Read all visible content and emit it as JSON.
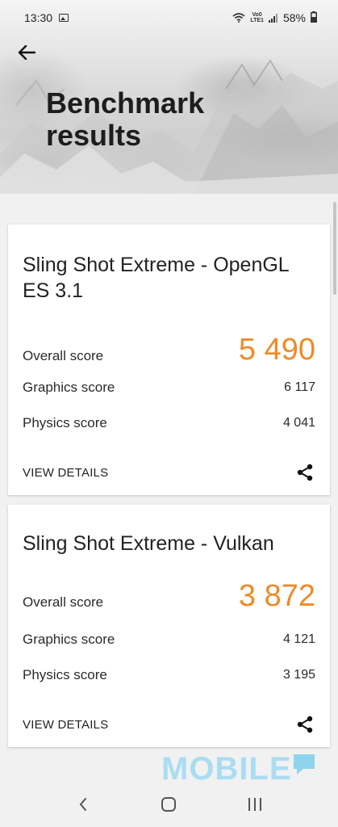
{
  "status_bar": {
    "time": "13:30",
    "volte_line1": "Vo0",
    "volte_line2": "LTE1",
    "battery": "58%"
  },
  "header": {
    "title": "Benchmark results"
  },
  "cards": [
    {
      "title": "Sling Shot Extreme - OpenGL ES 3.1",
      "overall_label": "Overall score",
      "overall_value": "5 490",
      "graphics_label": "Graphics score",
      "graphics_value": "6 117",
      "physics_label": "Physics score",
      "physics_value": "4 041",
      "details_label": "VIEW DETAILS"
    },
    {
      "title": "Sling Shot Extreme - Vulkan",
      "overall_label": "Overall score",
      "overall_value": "3 872",
      "graphics_label": "Graphics score",
      "graphics_value": "4 121",
      "physics_label": "Physics score",
      "physics_value": "3 195",
      "details_label": "VIEW DETAILS"
    }
  ],
  "watermark": "MOBILE",
  "colors": {
    "accent": "#ee8a28",
    "watermark": "#a9ddf2"
  },
  "icons": {
    "back": "arrow-left-icon",
    "share": "share-icon",
    "nav_back": "chevron-left-icon",
    "nav_home": "home-icon",
    "nav_recents": "recents-icon"
  }
}
